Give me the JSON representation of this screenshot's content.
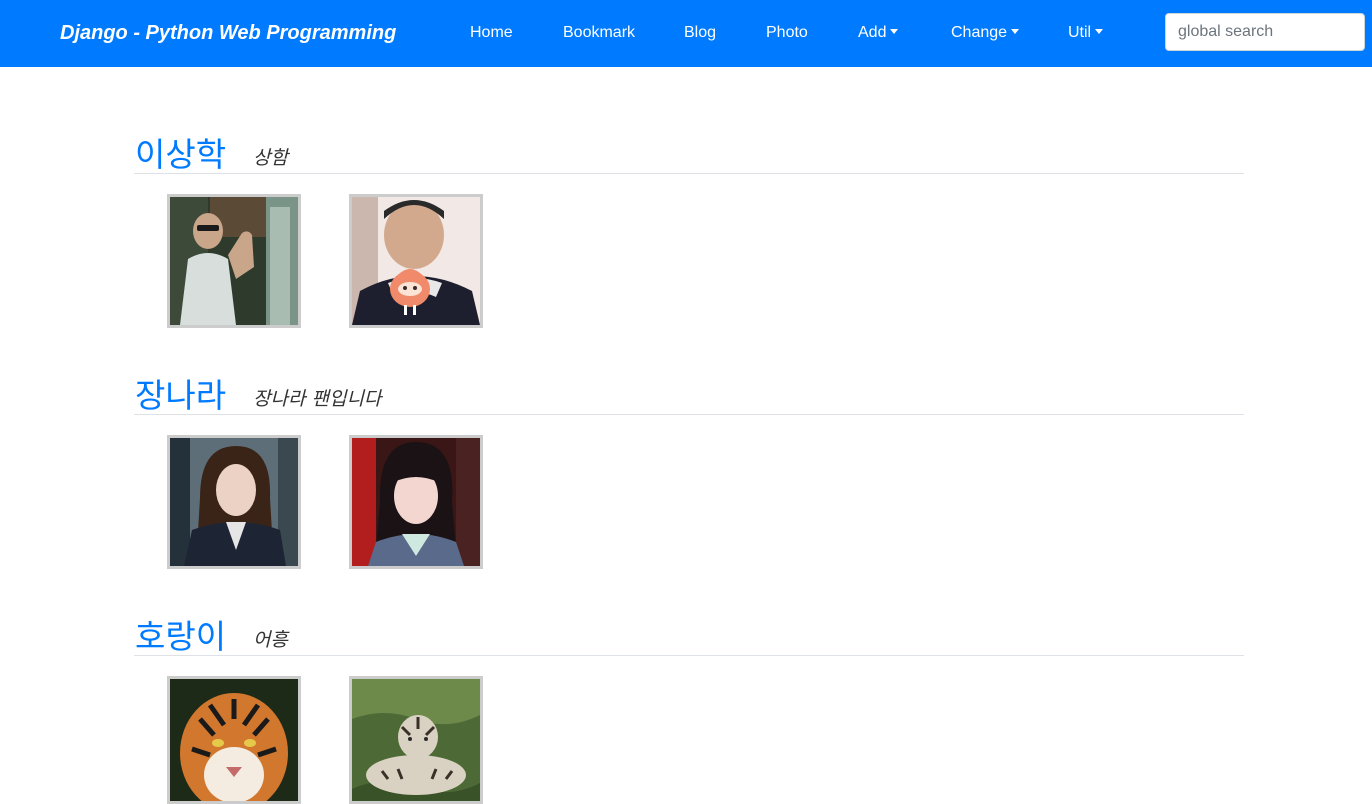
{
  "navbar": {
    "brand": "Django - Python Web Programming",
    "items": [
      {
        "label": "Home",
        "dropdown": false
      },
      {
        "label": "Bookmark",
        "dropdown": false
      },
      {
        "label": "Blog",
        "dropdown": false
      },
      {
        "label": "Photo",
        "dropdown": false
      },
      {
        "label": "Add",
        "dropdown": true
      },
      {
        "label": "Change",
        "dropdown": true
      },
      {
        "label": "Util",
        "dropdown": true
      }
    ],
    "search": {
      "placeholder": "global search",
      "value": ""
    },
    "bg_color": "#007bff"
  },
  "albums": [
    {
      "name": "이상학",
      "description": "상함",
      "photos": [
        "photo-person-waving",
        "photo-person-with-sticker"
      ]
    },
    {
      "name": "장나라",
      "description": "장나라 팬입니다",
      "photos": [
        "photo-woman-in-car",
        "photo-woman-portrait"
      ]
    },
    {
      "name": "호랑이",
      "description": "어흥",
      "photos": [
        "photo-tiger-face",
        "photo-tiger-lying"
      ]
    }
  ]
}
